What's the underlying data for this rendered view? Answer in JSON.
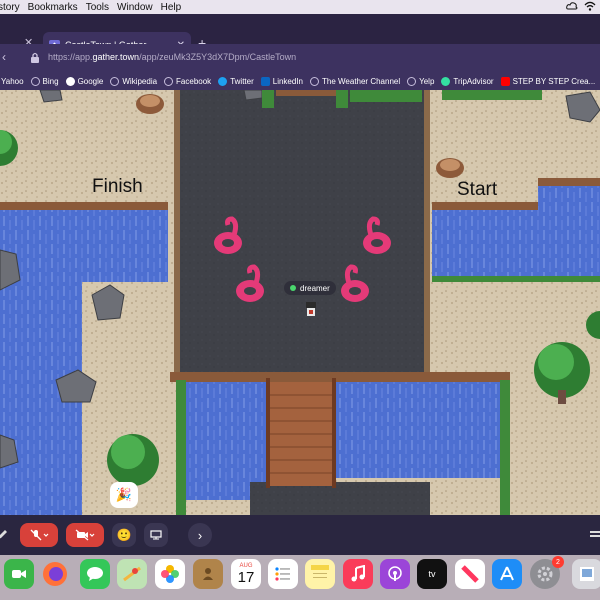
{
  "menubar": {
    "items": [
      "story",
      "Bookmarks",
      "Tools",
      "Window",
      "Help"
    ]
  },
  "browser": {
    "tab_title": "CastleTown | Gather",
    "url_scheme": "https://app.",
    "url_host": "gather.town",
    "url_path": "/app/zeuMk3Z5Y3dX7Dpm/CastleTown"
  },
  "bookmarks": [
    {
      "label": "Yahoo",
      "color": "#8a56c9"
    },
    {
      "label": "Bing",
      "color": "#9c8fbf"
    },
    {
      "label": "Google",
      "color": "#ffffff"
    },
    {
      "label": "Wikipedia",
      "color": "#9c8fbf"
    },
    {
      "label": "Facebook",
      "color": "#9c8fbf"
    },
    {
      "label": "Twitter",
      "color": "#1da1f2"
    },
    {
      "label": "LinkedIn",
      "color": "#0a66c2"
    },
    {
      "label": "The Weather Channel",
      "color": "#9c8fbf"
    },
    {
      "label": "Yelp",
      "color": "#9c8fbf"
    },
    {
      "label": "TripAdvisor",
      "color": "#34e0a1"
    },
    {
      "label": "STEP BY STEP Crea...",
      "color": "#ff0000"
    }
  ],
  "game": {
    "finish_label": "Finish",
    "start_label": "Start",
    "player_name": "dreamer",
    "status_color": "#4ad66d"
  },
  "toolbar": {
    "emoji": "🙂"
  },
  "dock": {
    "calendar_month": "AUG",
    "calendar_day": "17",
    "settings_badge": "2"
  }
}
